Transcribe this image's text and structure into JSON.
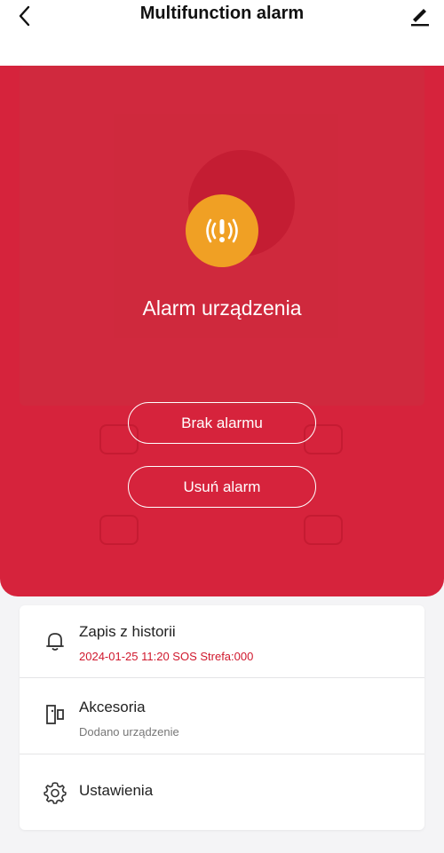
{
  "header": {
    "title": "Multifunction alarm",
    "back_icon": "chevron-left-icon",
    "edit_icon": "pencil-icon"
  },
  "alarm": {
    "title": "Alarm urządzenia",
    "icon": "alarm-warning-icon",
    "icon_color": "#f0a024",
    "background_color": "#d6233c",
    "buttons": {
      "no_alarm": "Brak alarmu",
      "remove_alarm": "Usuń alarm"
    }
  },
  "list": {
    "items": [
      {
        "icon": "bell-icon",
        "label": "Zapis z historii",
        "sub": "2024-01-25 11:20 SOS Strefa:000"
      },
      {
        "icon": "door-sensor-icon",
        "label": "Akcesoria",
        "sub": "Dodano urządzenie"
      },
      {
        "icon": "gear-icon",
        "label": "Ustawienia"
      }
    ]
  }
}
